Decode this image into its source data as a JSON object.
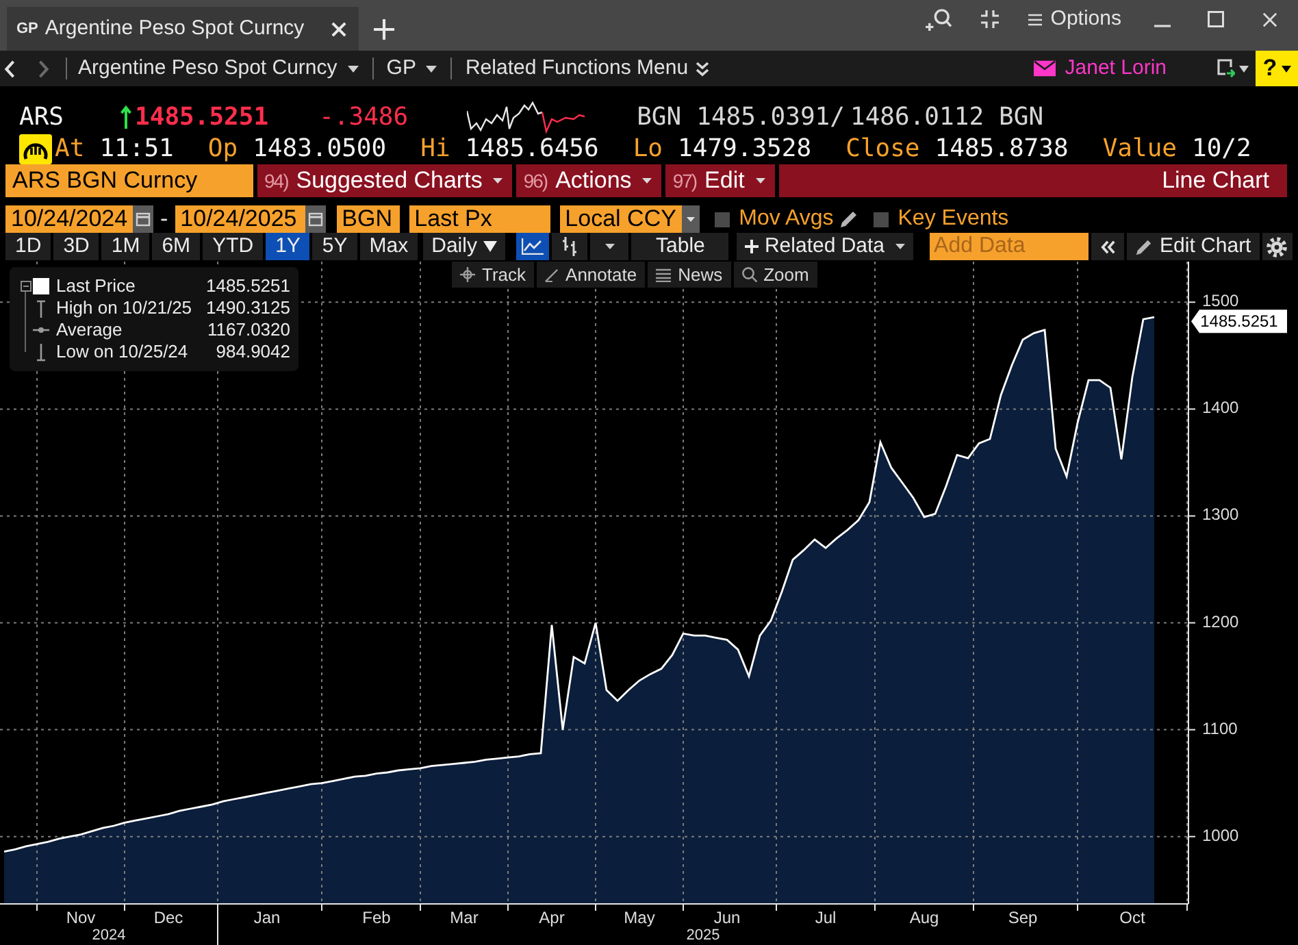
{
  "window": {
    "tab": {
      "prefix": "GP",
      "title": "Argentine Peso Spot Curncy"
    },
    "options": "Options"
  },
  "nav_bar": {
    "back_disabled": false,
    "forward_disabled": true,
    "security": "Argentine Peso Spot Curncy",
    "function": "GP",
    "menu": "Related Functions Menu",
    "user": "Janet Lorin",
    "help": "?"
  },
  "quote": {
    "ticker": "ARS",
    "tick_up": true,
    "price_down": true,
    "last": "1485.5251",
    "change": "-.3486",
    "bid_source": "BGN",
    "bid": "1485.0391",
    "separator": "/",
    "ask": "1486.0112",
    "ask_source": "BGN",
    "stats": [
      {
        "label": "At",
        "value": "11:51"
      },
      {
        "label": "Op",
        "value": "1483.0500"
      },
      {
        "label": "Hi",
        "value": "1485.6456"
      },
      {
        "label": "Lo",
        "value": "1479.3528"
      },
      {
        "label": "Close",
        "value": "1485.8738"
      },
      {
        "label": "Value",
        "value": "10/2"
      }
    ]
  },
  "command_bar": {
    "security": "ARS BGN Curncy",
    "menus": [
      {
        "number": "94)",
        "label": "Suggested Charts"
      },
      {
        "number": "96)",
        "label": "Actions"
      },
      {
        "number": "97)",
        "label": "Edit"
      }
    ],
    "chart_name": "Line Chart"
  },
  "settings": {
    "start_date": "10/24/2024",
    "date_separator": "-",
    "end_date": "10/24/2025",
    "source": "BGN",
    "field": "Last Px",
    "currency": "Local CCY",
    "toggles": [
      {
        "label": "Mov Avgs",
        "checked": false,
        "editable": true
      },
      {
        "label": "Key Events",
        "checked": false,
        "editable": false
      }
    ]
  },
  "toolbar": {
    "periods": [
      {
        "label": "1D",
        "selected": false
      },
      {
        "label": "3D",
        "selected": false
      },
      {
        "label": "1M",
        "selected": false
      },
      {
        "label": "6M",
        "selected": false
      },
      {
        "label": "YTD",
        "selected": false
      },
      {
        "label": "1Y",
        "selected": true
      },
      {
        "label": "5Y",
        "selected": false
      },
      {
        "label": "Max",
        "selected": false
      }
    ],
    "frequency": "Daily",
    "chart_types": [
      {
        "kind": "line",
        "selected": true
      },
      {
        "kind": "bars",
        "selected": false
      }
    ],
    "table": "Table",
    "related_data": "Related Data",
    "add_data": {
      "placeholder": "Add Data"
    },
    "edit_chart": "Edit Chart"
  },
  "chart": {
    "tools": [
      {
        "kind": "track",
        "label": "Track"
      },
      {
        "kind": "annotate",
        "label": "Annotate"
      },
      {
        "kind": "news",
        "label": "News"
      },
      {
        "kind": "zoom",
        "label": "Zoom"
      }
    ],
    "legend": [
      {
        "kind": "last",
        "label": "Last Price",
        "value": "1485.5251"
      },
      {
        "kind": "high",
        "label": "High on 10/21/25",
        "value": "1490.3125"
      },
      {
        "kind": "average",
        "label": "Average",
        "value": "1167.0320"
      },
      {
        "kind": "low",
        "label": "Low on 10/25/24",
        "value": "984.9042"
      }
    ],
    "price_tag": "1485.5251",
    "years": [
      "2024",
      "2025"
    ],
    "chart_data": {
      "type": "area",
      "grid": true,
      "categories": [
        null,
        null,
        null,
        null,
        null,
        null,
        null,
        "Nov",
        null,
        null,
        null,
        null,
        null,
        null,
        null,
        "Dec",
        null,
        null,
        null,
        null,
        null,
        null,
        null,
        null,
        "Jan",
        null,
        null,
        null,
        null,
        null,
        null,
        null,
        null,
        null,
        "Feb",
        null,
        null,
        null,
        null,
        null,
        null,
        null,
        "Mar",
        null,
        null,
        null,
        null,
        null,
        null,
        null,
        "Apr",
        null,
        null,
        null,
        null,
        null,
        null,
        null,
        "May",
        null,
        null,
        null,
        null,
        null,
        null,
        null,
        "Jun",
        null,
        null,
        null,
        null,
        null,
        null,
        null,
        null,
        "Jul",
        null,
        null,
        null,
        null,
        null,
        null,
        null,
        null,
        "Aug",
        null,
        null,
        null,
        null,
        null,
        null,
        null,
        null,
        "Sep",
        null,
        null,
        null,
        null,
        null,
        null,
        null,
        null,
        null,
        "Oct",
        null,
        null
      ],
      "series": [
        {
          "color": "#ffffff",
          "values": [
            986,
            988,
            991,
            993,
            995,
            998,
            1000,
            1002,
            1005,
            1008,
            1010,
            1013,
            1015,
            1017,
            1019,
            1021,
            1024,
            1026,
            1028,
            1030,
            1033,
            1035,
            1037,
            1039,
            1041,
            1043,
            1045,
            1047,
            1049,
            1050,
            1052,
            1054,
            1056,
            1057,
            1059,
            1060,
            1062,
            1063,
            1064,
            1066,
            1067,
            1068,
            1069,
            1070,
            1072,
            1073,
            1074,
            1075,
            1077,
            1078,
            1198,
            1100,
            1168,
            1162,
            1200,
            1137,
            1127,
            1137,
            1146,
            1152,
            1157,
            1170,
            1190,
            1188,
            1188,
            1186,
            1184,
            1175,
            1150,
            1188,
            1202,
            1229,
            1259,
            1268,
            1278,
            1270,
            1279,
            1287,
            1296,
            1313,
            1369,
            1345,
            1331,
            1317,
            1299,
            1302,
            1328,
            1357,
            1354,
            1368,
            1372,
            1413,
            1441,
            1465,
            1471,
            1474,
            1363,
            1337,
            1387,
            1427,
            1427,
            1420,
            1353,
            1430,
            1484,
            1486
          ]
        }
      ],
      "ylim": [
        937,
        1538
      ],
      "yticks": [
        1000,
        1100,
        1200,
        1300,
        1400,
        1500
      ]
    }
  }
}
